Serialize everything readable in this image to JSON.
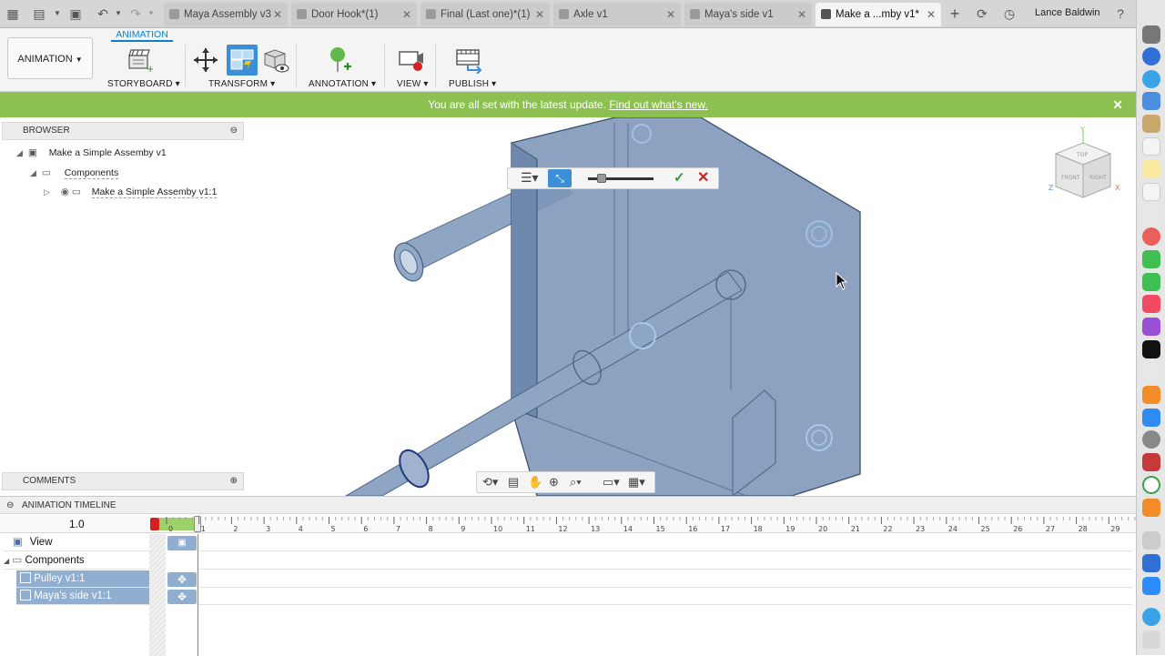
{
  "colors": {
    "accent": "#0d7fc9",
    "notify_bg": "#8cc152",
    "model_fill": "#7d95b8",
    "selection": "#8faed0",
    "confirm_green": "#3a9a2e",
    "cancel_red": "#cc2222"
  },
  "tabs": [
    {
      "label": "Maya Assembly v3",
      "active": false
    },
    {
      "label": "Door Hook*(1)",
      "active": false
    },
    {
      "label": "Final (Last one)*(1)",
      "active": false
    },
    {
      "label": "Axle v1",
      "active": false
    },
    {
      "label": "Maya's side v1",
      "active": false
    },
    {
      "label": "Make a ...mby v1*",
      "active": true
    }
  ],
  "user": {
    "name": "Lance Baldwin"
  },
  "ribbon": {
    "workspace": "ANIMATION",
    "active_tab": "ANIMATION",
    "groups": [
      {
        "label": "STORYBOARD"
      },
      {
        "label": "TRANSFORM"
      },
      {
        "label": "ANNOTATION"
      },
      {
        "label": "VIEW"
      },
      {
        "label": "PUBLISH"
      }
    ]
  },
  "notification": {
    "text": "You are all set with the latest update.",
    "link": "Find out what's new."
  },
  "browser": {
    "title": "BROWSER",
    "root": "Make a Simple Assemby v1",
    "folder": "Components",
    "component": "Make a Simple Assemby v1:1"
  },
  "comments": {
    "title": "COMMENTS"
  },
  "timeline": {
    "title": "ANIMATION TIMELINE",
    "scale": "1.0",
    "ticks": [
      "0",
      "1",
      "2",
      "3",
      "4",
      "5",
      "6",
      "7",
      "8",
      "9",
      "10",
      "11",
      "12",
      "13",
      "14",
      "15",
      "16",
      "17",
      "18",
      "19",
      "20",
      "21",
      "22",
      "23",
      "24",
      "25",
      "26",
      "27",
      "28",
      "29"
    ],
    "rows": [
      {
        "label": "View",
        "selected": false,
        "icon": "camera-icon"
      },
      {
        "label": "Components",
        "selected": false,
        "icon": "components-icon"
      },
      {
        "label": "Pulley v1:1",
        "selected": true,
        "icon": "component-icon"
      },
      {
        "label": "Maya's side v1:1",
        "selected": true,
        "icon": "component-icon"
      }
    ]
  },
  "viewcube": {
    "top": "TOP",
    "front": "FRONT",
    "right": "RIGHT",
    "axis_x": "X",
    "axis_y": "Y",
    "axis_z": "Z"
  }
}
